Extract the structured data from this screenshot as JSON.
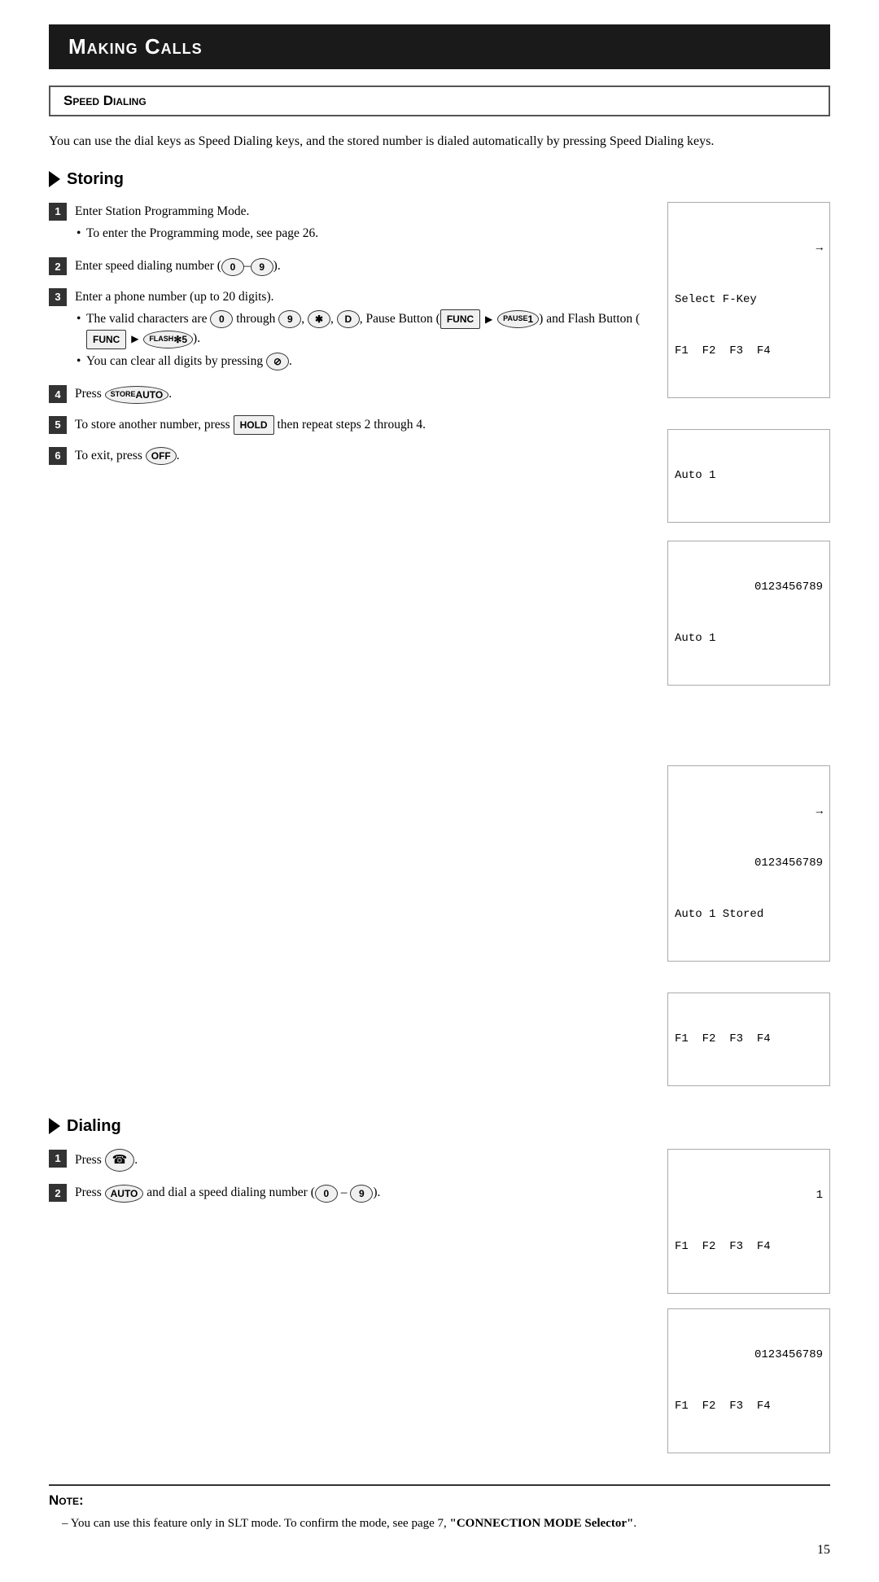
{
  "header": {
    "title": "Making Calls"
  },
  "section": {
    "title": "Speed Dialing"
  },
  "intro": {
    "text": "You can use the dial keys as Speed Dialing keys, and the stored number is dialed automatically by pressing Speed Dialing keys."
  },
  "storing": {
    "title": "Storing",
    "steps": [
      {
        "num": "1",
        "main": "Enter Station Programming Mode.",
        "bullets": [
          "To enter the Programming mode, see page 26."
        ]
      },
      {
        "num": "2",
        "main": "Enter speed dialing number (×0–×9)."
      },
      {
        "num": "3",
        "main": "Enter a phone number (up to 20 digits).",
        "bullets": [
          "The valid characters are ×0 through ×9, ★*, ■D, Pause Button (FUNC ► 1) and Flash Button (FUNC ► ⋅5).",
          "You can clear all digits by pressing ⓞ."
        ]
      },
      {
        "num": "4",
        "main": "Press AUTO."
      },
      {
        "num": "5",
        "main": "To store another number, press HOLD then repeat steps 2 through 4."
      },
      {
        "num": "6",
        "main": "To exit, press OFF."
      }
    ],
    "displays": [
      {
        "lines": [
          "→",
          "Select F-Key",
          "F1  F2  F3  F4"
        ]
      },
      {
        "lines": [
          "Auto 1"
        ]
      },
      {
        "lines": [
          "         0123456789",
          "Auto 1"
        ]
      },
      {
        "lines": [
          "→",
          "         0123456789",
          "Auto 1 Stored"
        ]
      },
      {
        "lines": [
          "F1  F2  F3  F4"
        ]
      }
    ]
  },
  "dialing": {
    "title": "Dialing",
    "steps": [
      {
        "num": "1",
        "main": "Press (phone icon)."
      },
      {
        "num": "2",
        "main": "Press AUTO and dial a speed dialing number (×0 – ×9)."
      }
    ],
    "displays": [
      {
        "lines": [
          "                   1",
          "F1  F2  F3  F4"
        ]
      },
      {
        "lines": [
          "         0123456789",
          "F1  F2  F3  F4"
        ]
      }
    ]
  },
  "note": {
    "title": "Note:",
    "content": "– You can use this feature only in SLT mode. To confirm the mode, see page 7, \"CONNECTION MODE Selector\"."
  },
  "page_number": "15"
}
